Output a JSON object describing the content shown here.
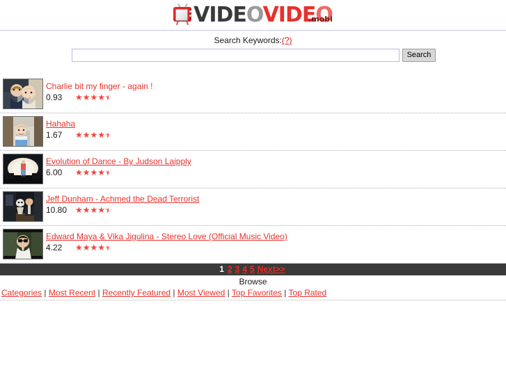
{
  "site": {
    "logo_parts": [
      {
        "text": "VIDE",
        "style": "dark"
      },
      {
        "text": "O",
        "style": "gray"
      },
      {
        "text": "VIDE",
        "style": "red"
      },
      {
        "text": "O",
        "style": "red-lt"
      }
    ],
    "logo_suffix": ".mobi",
    "tv_icon": "tv-icon"
  },
  "search": {
    "label": "Search Keywords:",
    "help_label": "(?)",
    "input_value": "",
    "placeholder": "",
    "button_label": "Search"
  },
  "videos": [
    {
      "title": "Charlie bit my finger - again !",
      "duration": "0.93",
      "rating": 4.5,
      "hovered": false,
      "thumb": "charlie-bit-my-finger-thumbnail"
    },
    {
      "title": "Hahaha",
      "duration": "1.67",
      "rating": 4.5,
      "hovered": true,
      "thumb": "hahaha-baby-thumbnail"
    },
    {
      "title": "Evolution of Dance - By Judson Laipply",
      "duration": "6.00",
      "rating": 4.5,
      "hovered": true,
      "thumb": "evolution-of-dance-thumbnail"
    },
    {
      "title": "Jeff Dunham - Achmed the Dead Terrorist",
      "duration": "10.80",
      "rating": 4.5,
      "hovered": true,
      "thumb": "jeff-dunham-achmed-thumbnail"
    },
    {
      "title": "Edward Maya & Vika Jigulina - Stereo Love (Official Music Video)",
      "duration": "4.22",
      "rating": 4.5,
      "hovered": true,
      "thumb": "stereo-love-thumbnail"
    }
  ],
  "pagination": {
    "current": "1",
    "links": [
      "2",
      "3",
      "4",
      "5",
      "Next>>"
    ]
  },
  "browse": {
    "title": "Browse",
    "links": [
      "Categories",
      "Most Recent",
      "Recently Featured",
      "Most Viewed",
      "Top Favorites",
      "Top Rated"
    ],
    "separator": "|"
  },
  "colors": {
    "link_red": "#e8312b",
    "star_red": "#f4453c",
    "pager_bg": "#3a3a3a",
    "rule": "#c9c9e8"
  }
}
